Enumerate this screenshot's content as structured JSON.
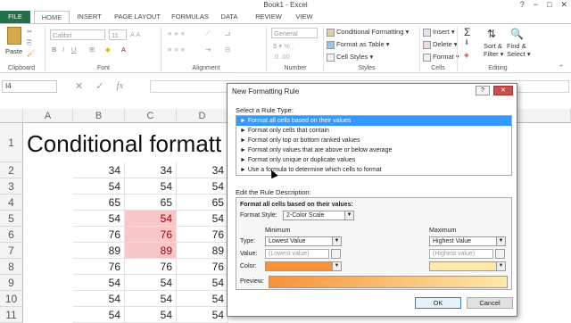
{
  "window": {
    "title": "Book1 - Excel",
    "controls": [
      "?",
      "−",
      "□",
      "✕"
    ]
  },
  "tabs": [
    "FILE",
    "HOME",
    "INSERT",
    "PAGE LAYOUT",
    "FORMULAS",
    "DATA",
    "REVIEW",
    "VIEW"
  ],
  "ribbon": {
    "clipboard": {
      "label": "Clipboard",
      "paste": "Paste"
    },
    "font": {
      "label": "Font",
      "name": "Calibri",
      "size": "11"
    },
    "alignment": {
      "label": "Alignment"
    },
    "number": {
      "label": "Number",
      "format": "General",
      "symbols": "$ ▾  %  ,",
      "decimals": ".0 .00"
    },
    "styles": {
      "label": "Styles",
      "items": [
        "Conditional Formatting ▾",
        "Format as Table ▾",
        "Cell Styles ▾"
      ]
    },
    "cells": {
      "label": "Cells",
      "items": [
        "Insert ▾",
        "Delete ▾",
        "Format ▾"
      ]
    },
    "editing": {
      "label": "Editing",
      "sort": "Sort &\nFilter ▾",
      "find": "Find &\nSelect ▾"
    }
  },
  "formula_bar": {
    "name_box": "I4",
    "fx": "fx"
  },
  "sheet": {
    "columns": [
      "A",
      "B",
      "C",
      "D"
    ],
    "rows": [
      "1",
      "2",
      "3",
      "4",
      "5",
      "6",
      "7",
      "8",
      "9",
      "10",
      "11"
    ],
    "title": "Conditional formatt",
    "col_b": [
      "34",
      "54",
      "65",
      "54",
      "76",
      "89",
      "76",
      "54",
      "54",
      "54",
      "56"
    ],
    "col_c": [
      "34",
      "54",
      "65",
      "54",
      "76",
      "89",
      "76",
      "54",
      "54",
      "54",
      "56"
    ],
    "col_d": [
      "34",
      "54",
      "65",
      "54",
      "76",
      "89",
      "76",
      "54",
      "54",
      "54",
      "56"
    ],
    "highlight_color": "#f9c6c8",
    "highlight_text_color": "#9c0006"
  },
  "dialog": {
    "title": "New Formatting Rule",
    "select_rule_type": "Select a Rule Type:",
    "rule_types": [
      "► Format all cells based on their values",
      "► Format only cells that contain",
      "► Format only top or bottom ranked values",
      "► Format only values that are above or below average",
      "► Format only unique or duplicate values",
      "► Use a formula to determine which cells to format"
    ],
    "edit_description": "Edit the Rule Description:",
    "format_all_label": "Format all cells based on their values:",
    "format_style_label": "Format Style:",
    "format_style_value": "2-Color Scale",
    "minimum": "Minimum",
    "maximum": "Maximum",
    "type_label": "Type:",
    "value_label": "Value:",
    "color_label": "Color:",
    "min_type": "Lowest Value",
    "max_type": "Highest Value",
    "min_value": "(Lowest value)",
    "max_value": "(Highest value)",
    "min_color": "#f7923b",
    "max_color": "#fde9a9",
    "preview_label": "Preview:",
    "ok": "OK",
    "cancel": "Cancel"
  }
}
